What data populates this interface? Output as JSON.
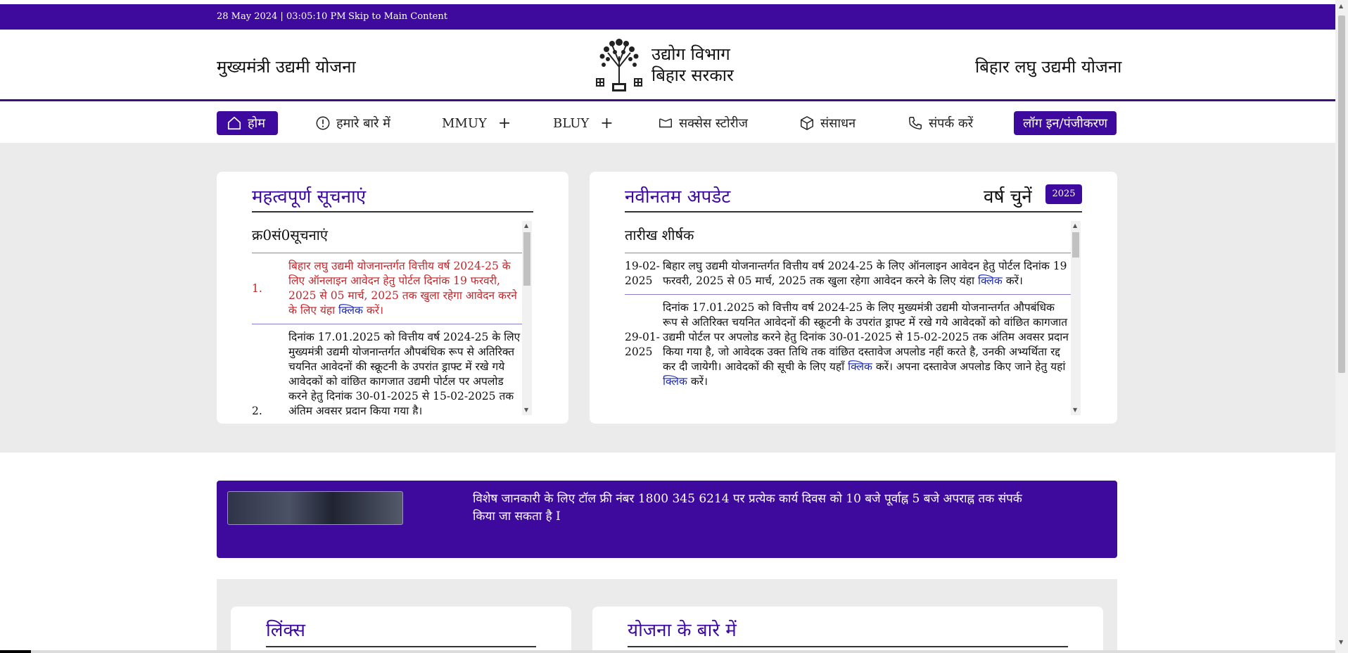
{
  "topbar": {
    "datetime": "28 May 2024 | 03:05:10 PM",
    "skip_link": "Skip to Main Content"
  },
  "header": {
    "left_title": "मुख्यमंत्री उद्यमी योजना",
    "dept_line1": "उद्योग विभाग",
    "dept_line2": "बिहार सरकार",
    "right_title": "बिहार लघु उद्यमी योजना"
  },
  "nav": {
    "home": "होम",
    "about": "हमारे बारे में",
    "mmuy": "MMUY",
    "bluy": "BLUY",
    "success": "सक्सेस स्टोरीज",
    "resources": "संसाधन",
    "contact": "संपर्क करें",
    "login": "लॉग इन/पंजीकरण",
    "plus": "+"
  },
  "notices": {
    "title": "महत्वपूर्ण सूचनाएं",
    "col_sno": "क्र0सं0",
    "col_notice": "सूचनाएं",
    "items": [
      {
        "num": "1.",
        "text": "बिहार लघु उद्यमी योजनान्तर्गत वित्तीय वर्ष 2024-25 के लिए ऑनलाइन आवेदन हेतु पोर्टल दिनांक 19 फरवरी, 2025 से 05 मार्च, 2025 तक खुला रहेगा आवेदन करने के लिए यंहा",
        "link": "क्लिक",
        "tail": "करें।"
      },
      {
        "num": "2.",
        "text": "दिनांक 17.01.2025 को वित्तीय वर्ष 2024-25 के लिए मुख्यमंत्री उद्यमी योजनान्तर्गत औपबंधिक रूप से अतिरिक्त चयनित आवेदनों की स्क्रूटनी के उपरांत ड्राफ्ट में रखे गये आवेदकों को वांछित कागजात उद्यमी पोर्टल पर अपलोड करने हेतु दिनांक 30-01-2025 से 15-02-2025 तक अंतिम अवसर प्रदान किया गया है।",
        "link": "",
        "tail": ""
      }
    ]
  },
  "updates": {
    "title": "नवीनतम अपडेट",
    "year_label": "वर्ष चुनें",
    "year_value": "2025",
    "col_date": "तारीख",
    "col_title": "शीर्षक",
    "items": [
      {
        "date": "19-02-2025",
        "text": "बिहार लघु उद्यमी योजनान्तर्गत वित्तीय वर्ष 2024-25 के लिए ऑनलाइन आवेदन हेतु पोर्टल दिनांक 19 फरवरी, 2025 से 05 मार्च, 2025 तक खुला रहेगा आवेदन करने के लिए यंहा",
        "link": "क्लिक",
        "tail": "करें।"
      },
      {
        "date": "29-01-2025",
        "text": "दिनांक 17.01.2025 को वित्तीय वर्ष 2024-25 के लिए मुख्यमंत्री उद्यमी योजनान्तर्गत औपबंधिक रूप से अतिरिक्त चयनित आवेदनों की स्क्रूटनी के उपरांत ड्राफ्ट में रखे गये आवेदकों को वांछित कागजात उद्यमी पोर्टल पर अपलोड करने हेतु दिनांक 30-01-2025 से 15-02-2025 तक अंतिम अवसर प्रदान किया गया है, जो आवेदक उक्त तिथि तक वांछित दस्तावेज अपलोड नहीं करते है, उनकी अभ्यर्थिता रद्द कर दी जायेगी। आवेदकों की सूची के लिए यहाँ",
        "link": "क्लिक",
        "mid": "करें। अपना दस्तावेज अपलोड किए जाने हेतु यहां",
        "link2": "क्लिक",
        "tail": "करें।"
      }
    ]
  },
  "banner": {
    "message": "विशेष जानकारी के लिए टॉल फ्री नंबर 1800 345 6214 पर प्रत्येक कार्य दिवस को 10 बजे पूर्वाह्न 5 बजे अपराह्न तक संपर्क किया जा सकता है I"
  },
  "links_section": {
    "title": "लिंक्स"
  },
  "about_section": {
    "title": "योजना के बारे में"
  },
  "colors": {
    "brand": "#3e0a9e",
    "notice_red": "#c0282d",
    "link_blue": "#1f2db3"
  }
}
